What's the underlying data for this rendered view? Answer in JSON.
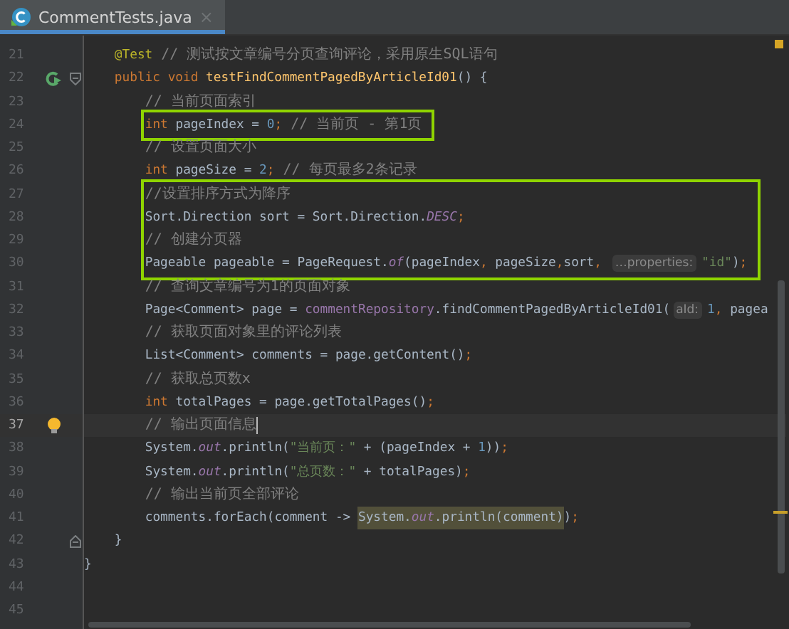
{
  "tab": {
    "title": "CommentTests.java",
    "close": "×",
    "selected": true
  },
  "editor": {
    "lines": [
      {
        "kind": "block",
        "children": [
          {
            "kind": "line",
            "number": "21",
            "tokens": [
              {
                "kind": "ann",
                "text": "@Test"
              },
              {
                "kind": "cmt",
                "text": " // 测试按文章编号分页查询评论，采用原生SQL语句"
              }
            ]
          },
          {
            "kind": "line",
            "number": "22",
            "gutter_icon": {
              "kind": "run"
            },
            "fold_icon": {
              "kind": "start"
            },
            "tokens": [
              {
                "kind": "kw",
                "text": "public void "
              },
              {
                "kind": "fn",
                "text": "testFindCommentPagedByArticleId01"
              },
              {
                "kind": "txt",
                "text": "() {"
              }
            ]
          },
          {
            "kind": "block",
            "children": [
              {
                "kind": "line",
                "number": "23",
                "tokens": [
                  {
                    "kind": "cmt",
                    "text": "// 当前页面索引"
                  }
                ]
              },
              {
                "kind": "highlight",
                "children": [
                  {
                    "kind": "line",
                    "number": "24",
                    "tokens": [
                      {
                        "kind": "kw",
                        "text": "int "
                      },
                      {
                        "kind": "txt",
                        "text": "pageIndex = "
                      },
                      {
                        "kind": "num",
                        "text": "0"
                      },
                      {
                        "kind": "punc",
                        "text": ";"
                      },
                      {
                        "kind": "cmt",
                        "text": " // 当前页 - 第1页"
                      }
                    ]
                  }
                ]
              },
              {
                "kind": "line",
                "number": "25",
                "tokens": [
                  {
                    "kind": "cmt",
                    "text": "// 设置页面大小"
                  }
                ]
              },
              {
                "kind": "line",
                "number": "26",
                "tokens": [
                  {
                    "kind": "kw",
                    "text": "int "
                  },
                  {
                    "kind": "txt",
                    "text": "pageSize = "
                  },
                  {
                    "kind": "num",
                    "text": "2"
                  },
                  {
                    "kind": "punc",
                    "text": ";"
                  },
                  {
                    "kind": "cmt",
                    "text": " // 每页最多2条记录"
                  }
                ]
              },
              {
                "kind": "highlight",
                "children": [
                  {
                    "kind": "line",
                    "number": "27",
                    "tokens": [
                      {
                        "kind": "cmt",
                        "text": "//设置排序方式为降序"
                      }
                    ]
                  },
                  {
                    "kind": "line",
                    "number": "28",
                    "tokens": [
                      {
                        "kind": "txt",
                        "text": "Sort.Direction sort = Sort.Direction."
                      },
                      {
                        "kind": "fld",
                        "text": "DESC"
                      },
                      {
                        "kind": "punc",
                        "text": ";"
                      }
                    ]
                  },
                  {
                    "kind": "line",
                    "number": "29",
                    "tokens": [
                      {
                        "kind": "cmt",
                        "text": "// 创建分页器"
                      }
                    ]
                  },
                  {
                    "kind": "line",
                    "number": "30",
                    "tokens": [
                      {
                        "kind": "txt",
                        "text": "Pageable pageable = PageRequest."
                      },
                      {
                        "kind": "fld",
                        "text": "of"
                      },
                      {
                        "kind": "txt",
                        "text": "(pageIndex"
                      },
                      {
                        "kind": "punc",
                        "text": ", "
                      },
                      {
                        "kind": "txt",
                        "text": "pageSize"
                      },
                      {
                        "kind": "punc",
                        "text": ","
                      },
                      {
                        "kind": "txt",
                        "text": "sort"
                      },
                      {
                        "kind": "punc",
                        "text": ", "
                      },
                      {
                        "kind": "hint",
                        "text": "…properties:"
                      },
                      {
                        "kind": "str",
                        "text": "\"id\""
                      },
                      {
                        "kind": "txt",
                        "text": ")"
                      },
                      {
                        "kind": "punc",
                        "text": ";"
                      }
                    ]
                  }
                ]
              },
              {
                "kind": "line",
                "number": "31",
                "tokens": [
                  {
                    "kind": "cmt",
                    "text": "// 查询文章编号为1的页面对象"
                  }
                ]
              },
              {
                "kind": "line",
                "number": "32",
                "tokens": [
                  {
                    "kind": "txt",
                    "text": "Page<Comment> page = "
                  },
                  {
                    "kind": "mem",
                    "text": "commentRepository"
                  },
                  {
                    "kind": "txt",
                    "text": ".findCommentPagedByArticleId01("
                  },
                  {
                    "kind": "hint",
                    "text": "aId:"
                  },
                  {
                    "kind": "num",
                    "text": "1"
                  },
                  {
                    "kind": "punc",
                    "text": ", "
                  },
                  {
                    "kind": "txt",
                    "text": "pagea"
                  }
                ]
              },
              {
                "kind": "line",
                "number": "33",
                "tokens": [
                  {
                    "kind": "cmt",
                    "text": "// 获取页面对象里的评论列表"
                  }
                ]
              },
              {
                "kind": "line",
                "number": "34",
                "tokens": [
                  {
                    "kind": "txt",
                    "text": "List<Comment> comments = page.getContent()"
                  },
                  {
                    "kind": "punc",
                    "text": ";"
                  }
                ]
              },
              {
                "kind": "line",
                "number": "35",
                "tokens": [
                  {
                    "kind": "cmt",
                    "text": "// 获取总页数x"
                  }
                ]
              },
              {
                "kind": "line",
                "number": "36",
                "tokens": [
                  {
                    "kind": "kw",
                    "text": "int "
                  },
                  {
                    "kind": "txt",
                    "text": "totalPages = page.getTotalPages()"
                  },
                  {
                    "kind": "punc",
                    "text": ";"
                  }
                ]
              },
              {
                "kind": "line",
                "number": "37",
                "gutter_icon": {
                  "kind": "bulb"
                },
                "current": true,
                "tokens": [
                  {
                    "kind": "cmt",
                    "text": "// 输出页面信息"
                  }
                ]
              },
              {
                "kind": "line",
                "number": "38",
                "tokens": [
                  {
                    "kind": "txt",
                    "text": "System."
                  },
                  {
                    "kind": "fld",
                    "text": "out"
                  },
                  {
                    "kind": "txt",
                    "text": ".println("
                  },
                  {
                    "kind": "str",
                    "text": "\"当前页：\""
                  },
                  {
                    "kind": "txt",
                    "text": " + (pageIndex + "
                  },
                  {
                    "kind": "num",
                    "text": "1"
                  },
                  {
                    "kind": "txt",
                    "text": "))"
                  },
                  {
                    "kind": "punc",
                    "text": ";"
                  }
                ]
              },
              {
                "kind": "line",
                "number": "39",
                "tokens": [
                  {
                    "kind": "txt",
                    "text": "System."
                  },
                  {
                    "kind": "fld",
                    "text": "out"
                  },
                  {
                    "kind": "txt",
                    "text": ".println("
                  },
                  {
                    "kind": "str",
                    "text": "\"总页数：\""
                  },
                  {
                    "kind": "txt",
                    "text": " + totalPages)"
                  },
                  {
                    "kind": "punc",
                    "text": ";"
                  }
                ]
              },
              {
                "kind": "line",
                "number": "40",
                "tokens": [
                  {
                    "kind": "cmt",
                    "text": "// 输出当前页全部评论"
                  }
                ]
              },
              {
                "kind": "line",
                "number": "41",
                "tokens": [
                  {
                    "kind": "txt",
                    "text": "comments.forEach(comment -> "
                  },
                  {
                    "kind": "txt",
                    "text": "System.",
                    "mark": true
                  },
                  {
                    "kind": "fld",
                    "text": "out",
                    "mark": true
                  },
                  {
                    "kind": "txt",
                    "text": ".println(comment)",
                    "mark": true
                  },
                  {
                    "kind": "txt",
                    "text": ")"
                  },
                  {
                    "kind": "punc",
                    "text": ";"
                  }
                ]
              }
            ]
          },
          {
            "kind": "line",
            "number": "42",
            "fold_icon": {
              "kind": "end"
            },
            "tokens": [
              {
                "kind": "txt",
                "text": "}"
              }
            ]
          }
        ]
      },
      {
        "kind": "line",
        "number": "43",
        "tokens": [
          {
            "kind": "txt",
            "text": "}"
          }
        ]
      },
      {
        "kind": "line",
        "number": "44"
      },
      {
        "kind": "line",
        "number": "45"
      }
    ]
  }
}
